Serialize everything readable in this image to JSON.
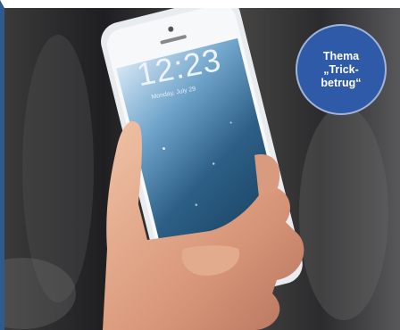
{
  "badge": {
    "line1": "Thema",
    "line2": "„Trick-",
    "line3": "betrug“"
  },
  "phone_screen": {
    "time": "12:23",
    "date": "Monday, July 29"
  },
  "colors": {
    "frame_blue": "#2f5a8f",
    "badge_blue": "#2f5aa8"
  }
}
